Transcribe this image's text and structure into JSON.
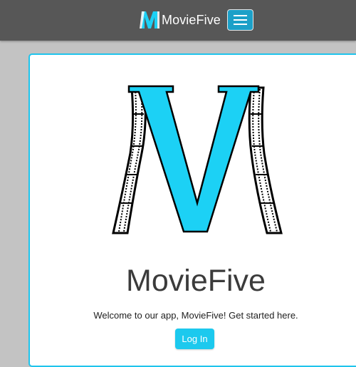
{
  "navbar": {
    "brand_name": "MovieFive",
    "logo_icon": "moviefive-logo-icon",
    "menu_icon": "hamburger-menu-icon",
    "background": "#575757",
    "toggler_color": "#1ca0c8"
  },
  "main": {
    "logo_icon": "moviefive-film-v-logo",
    "title": "MovieFive",
    "welcome_text": "Welcome to our app, MovieFive! Get started here.",
    "login_button": "Log In",
    "accent_color": "#1cc9ee"
  }
}
